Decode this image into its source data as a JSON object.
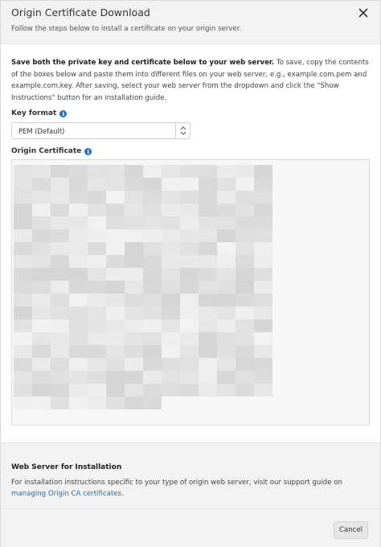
{
  "header": {
    "title": "Origin Certificate Download",
    "subtitle": "Follow the steps below to install a certificate on your origin server."
  },
  "intro": {
    "bold": "Save both the private key and certificate below to your web server.",
    "text": " To save, copy the contents of the boxes below and paste them into different files on your web server, e.g., example.com.pem and example.com.key. After saving, select your web server from the dropdown and click the \"Show Instructions\" button for an installation guide."
  },
  "key_format": {
    "label": "Key format",
    "selected": "PEM (Default)"
  },
  "origin_certificate": {
    "label": "Origin Certificate"
  },
  "web_server": {
    "title": "Web Server for Installation",
    "text": "For installation instructions specific to your type of origin web server, visit our support guide on ",
    "link": "managing Origin CA certificates",
    "after_link": "."
  },
  "footer": {
    "cancel_label": "Cancel"
  },
  "colors": {
    "accent": "#1a6fc2",
    "info_icon": "#1f6fce",
    "header_bg": "#f2f2f2"
  },
  "icons": [
    "close-icon",
    "info-icon",
    "select-arrows-icon"
  ]
}
